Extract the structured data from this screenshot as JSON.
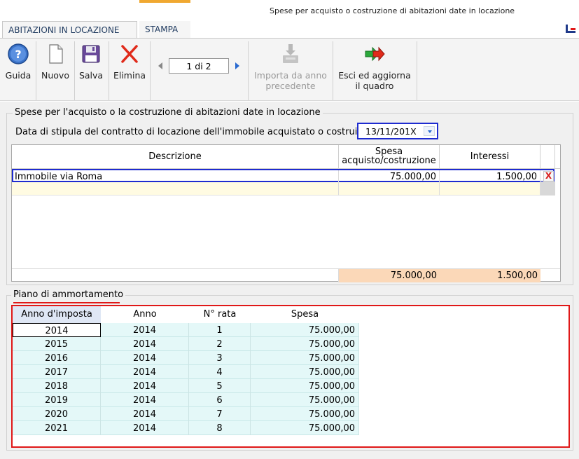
{
  "window": {
    "title": "Spese per acquisto o costruzione di abitazioni date in locazione"
  },
  "tabs": [
    {
      "label": "ABITAZIONI IN LOCAZIONE"
    },
    {
      "label": "STAMPA"
    }
  ],
  "toolbar": {
    "guida": "Guida",
    "nuovo": "Nuovo",
    "salva": "Salva",
    "elimina": "Elimina",
    "page_indicator": "1 di 2",
    "importa_line1": "Importa da anno",
    "importa_line2": "precedente",
    "esci_line1": "Esci ed aggiorna",
    "esci_line2": "il quadro"
  },
  "section1": {
    "legend": "Spese per l'acquisto o la costruzione di abitazioni date in locazione",
    "date_label": "Data di stipula del contratto di locazione dell'immobile acquistato o costruito",
    "date_value": "13/11/201X",
    "columns": {
      "descrizione": "Descrizione",
      "spesa_line1": "Spesa",
      "spesa_line2": "acquisto/costruzione",
      "interessi": "Interessi"
    },
    "rows": [
      {
        "descrizione": "Immobile via Roma",
        "spesa": "75.000,00",
        "interessi": "1.500,00",
        "delete": "X"
      }
    ],
    "totals": {
      "spesa": "75.000,00",
      "interessi": "1.500,00"
    }
  },
  "section2": {
    "legend": "Piano di ammortamento",
    "columns": [
      "Anno d'imposta",
      "Anno",
      "N° rata",
      "Spesa"
    ],
    "rows": [
      {
        "anno_imposta": "2014",
        "anno": "2014",
        "rata": "1",
        "spesa": "75.000,00"
      },
      {
        "anno_imposta": "2015",
        "anno": "2014",
        "rata": "2",
        "spesa": "75.000,00"
      },
      {
        "anno_imposta": "2016",
        "anno": "2014",
        "rata": "3",
        "spesa": "75.000,00"
      },
      {
        "anno_imposta": "2017",
        "anno": "2014",
        "rata": "4",
        "spesa": "75.000,00"
      },
      {
        "anno_imposta": "2018",
        "anno": "2014",
        "rata": "5",
        "spesa": "75.000,00"
      },
      {
        "anno_imposta": "2019",
        "anno": "2014",
        "rata": "6",
        "spesa": "75.000,00"
      },
      {
        "anno_imposta": "2020",
        "anno": "2014",
        "rata": "7",
        "spesa": "75.000,00"
      },
      {
        "anno_imposta": "2021",
        "anno": "2014",
        "rata": "8",
        "spesa": "75.000,00"
      }
    ]
  },
  "colors": {
    "accent_blue": "#1e2bd0",
    "highlight_red": "#e01818",
    "totals_bg": "#fbd8b8",
    "amort_row_bg": "#e4f8f8",
    "tab_accent": "#f0a830"
  }
}
